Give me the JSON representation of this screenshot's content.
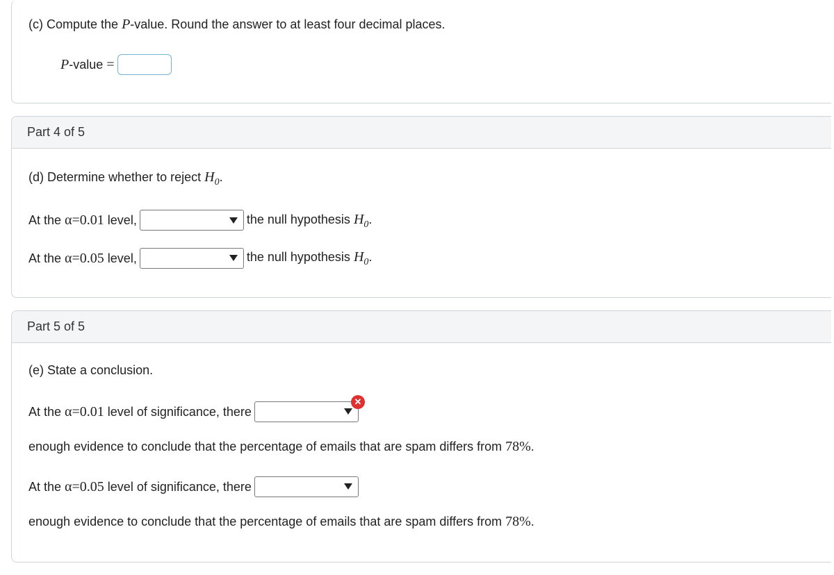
{
  "partC": {
    "prompt_prefix": "(c) Compute the ",
    "prompt_var": "P",
    "prompt_suffix": "-value. Round the answer to at least four decimal places.",
    "label_var": "P",
    "label_suffix": "-value",
    "equals": "="
  },
  "part4": {
    "header": "Part 4 of 5",
    "prompt_prefix": "(d) Determine whether to reject ",
    "h0_sym": "H",
    "h0_sub": "0",
    "dot": ".",
    "lines": [
      {
        "prefix": "At the ",
        "alpha": "α",
        "eq": "=",
        "val": "0.01",
        "level": " level,",
        "after": " the null hypothesis "
      },
      {
        "prefix": "At the ",
        "alpha": "α",
        "eq": "=",
        "val": "0.05",
        "level": " level,",
        "after": " the null hypothesis "
      }
    ]
  },
  "part5": {
    "header": "Part 5 of 5",
    "prompt": "(e) State a conclusion.",
    "lines": [
      {
        "prefix": "At the ",
        "alpha": "α",
        "eq": "=",
        "val": "0.01",
        "sig": " level of significance, there ",
        "after": " enough evidence to conclude that the percentage of emails that are spam differs from ",
        "pct": "78%",
        "dot": ".",
        "error": true
      },
      {
        "prefix": "At the ",
        "alpha": "α",
        "eq": "=",
        "val": "0.05",
        "sig": " level of significance, there ",
        "after": " enough evidence to conclude that the percentage of emails that are spam differs from ",
        "pct": "78%",
        "dot": ".",
        "error": false
      }
    ]
  },
  "icons": {
    "err": "✕"
  }
}
